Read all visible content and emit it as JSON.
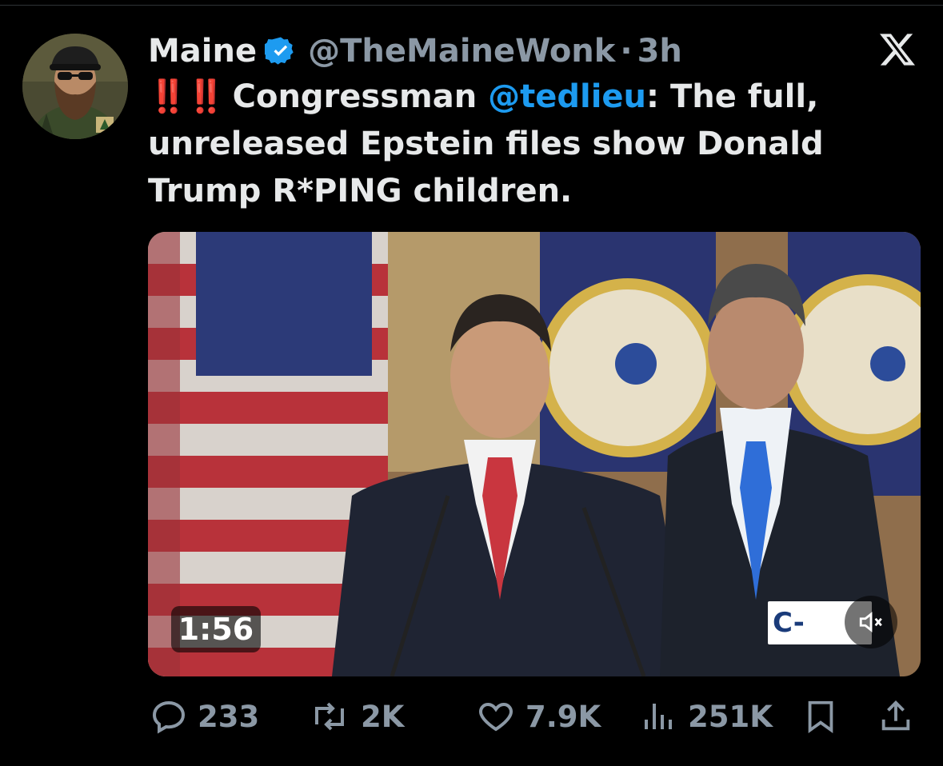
{
  "author": {
    "name": "Maine",
    "handle": "@TheMaineWonk",
    "separator": "·",
    "time": "3h",
    "verified_icon": "verified-badge-icon"
  },
  "tweet": {
    "bangs": "‼️‼️",
    "text_before_mention": "Congressman ",
    "mention": "@tedlieu",
    "text_after_mention": ": The full, unreleased Epstein files show Donald Trump R*PING children."
  },
  "media": {
    "duration": "1:56",
    "watermark": "C-SPAN",
    "mute_icon": "speaker-muted-icon"
  },
  "actions": {
    "replies": "233",
    "reposts": "2K",
    "likes": "7.9K",
    "views": "251K"
  },
  "colors": {
    "background": "#000000",
    "text": "#e7e9ea",
    "secondary": "#8b98a5",
    "accent": "#1d9bf0",
    "alert": "#f4212e"
  }
}
